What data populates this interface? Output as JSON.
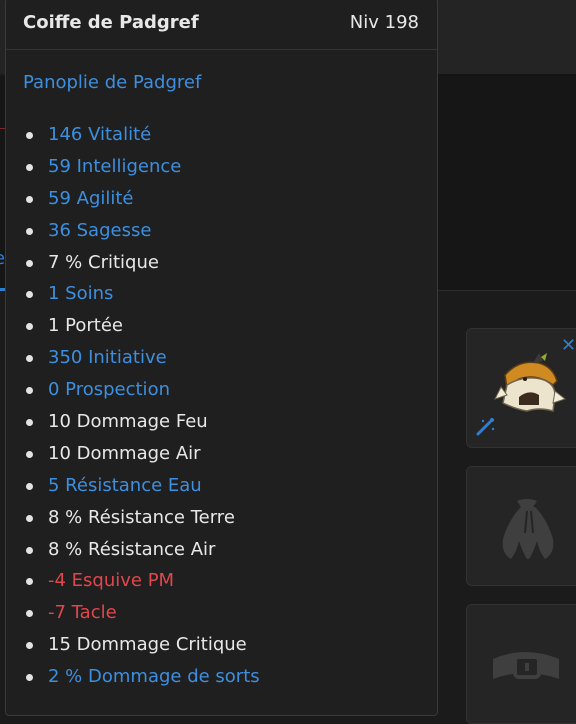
{
  "tooltip": {
    "item_name": "Coiffe de Padgref",
    "level": "Niv 198",
    "set_name": "Panoplie de Padgref",
    "stats": [
      {
        "text": "146 Vitalité",
        "tone": "blue"
      },
      {
        "text": "59 Intelligence",
        "tone": "blue"
      },
      {
        "text": "59 Agilité",
        "tone": "blue"
      },
      {
        "text": "36 Sagesse",
        "tone": "blue"
      },
      {
        "text": "7 % Critique",
        "tone": "white"
      },
      {
        "text": "1 Soins",
        "tone": "blue"
      },
      {
        "text": "1 Portée",
        "tone": "white"
      },
      {
        "text": "350 Initiative",
        "tone": "blue"
      },
      {
        "text": "0 Prospection",
        "tone": "blue"
      },
      {
        "text": "10 Dommage Feu",
        "tone": "white"
      },
      {
        "text": "10 Dommage Air",
        "tone": "white"
      },
      {
        "text": "5 Résistance Eau",
        "tone": "blue"
      },
      {
        "text": "8 % Résistance Terre",
        "tone": "white"
      },
      {
        "text": "8 % Résistance Air",
        "tone": "white"
      },
      {
        "text": "-4 Esquive PM",
        "tone": "red"
      },
      {
        "text": "-7 Tacle",
        "tone": "red"
      },
      {
        "text": "15 Dommage Critique",
        "tone": "white"
      },
      {
        "text": "2 % Dommage de sorts",
        "tone": "blue"
      }
    ]
  },
  "colors": {
    "blue": "#3d8fe0",
    "white": "#e8e8e8",
    "red": "#e0474d"
  },
  "equipment_slots": [
    {
      "kind": "hat",
      "icons": [
        "helmet-item-icon",
        "close-icon",
        "magic-wand-icon"
      ]
    },
    {
      "kind": "cloak",
      "icons": [
        "cloak-placeholder-icon"
      ]
    },
    {
      "kind": "belt",
      "icons": [
        "belt-placeholder-icon"
      ]
    }
  ]
}
